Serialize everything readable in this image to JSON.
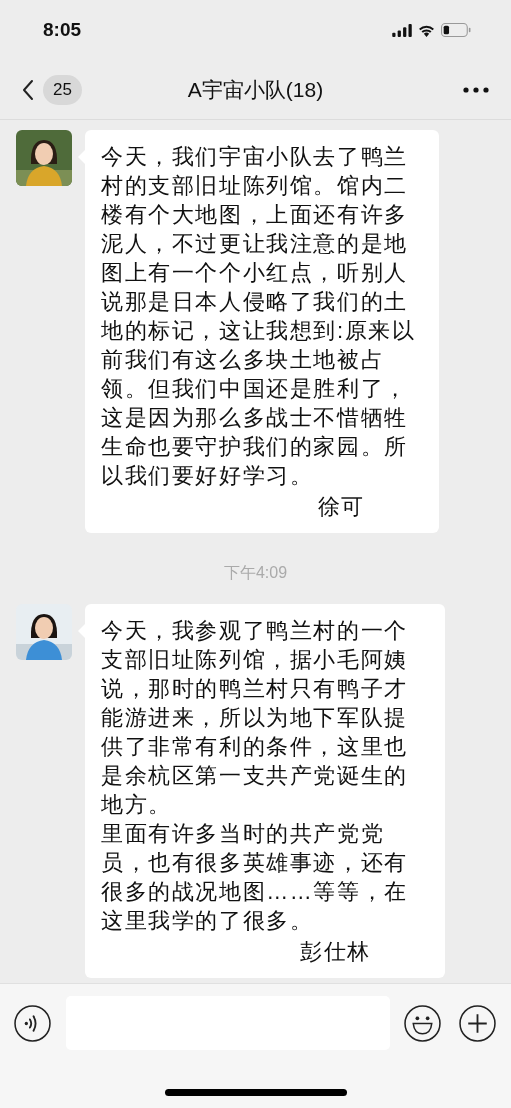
{
  "status_bar": {
    "time": "8:05"
  },
  "header": {
    "unread_count": "25",
    "title": "A宇宙小队(18)"
  },
  "messages": [
    {
      "kind": "message",
      "paragraphs": [
        "今天，我们宇宙小队去了鸭兰村的支部旧址陈列馆。馆内二楼有个大地图，上面还有许多泥人，不过更让我注意的是地图上有一个个小红点，听别人说那是日本人侵略了我们的土地的标记，这让我想到:原来以前我们有这么多块土地被占领。但我们中国还是胜利了，这是因为那么多战士不惜牺牲生命也要守护我们的家园。所以我们要好好学习。"
      ],
      "signature": "徐可"
    },
    {
      "kind": "time",
      "text": "下午4:09"
    },
    {
      "kind": "message",
      "paragraphs": [
        "今天，我参观了鸭兰村的一个支部旧址陈列馆，据小毛阿姨说，那时的鸭兰村只有鸭子才能游进来，所以为地下军队提供了非常有利的条件，这里也是余杭区第一支共产党诞生的地方。",
        "里面有许多当时的共产党党员，也有很多英雄事迹，还有很多的战况地图……等等，在这里我学的了很多。"
      ],
      "signature": "彭仕林"
    }
  ]
}
